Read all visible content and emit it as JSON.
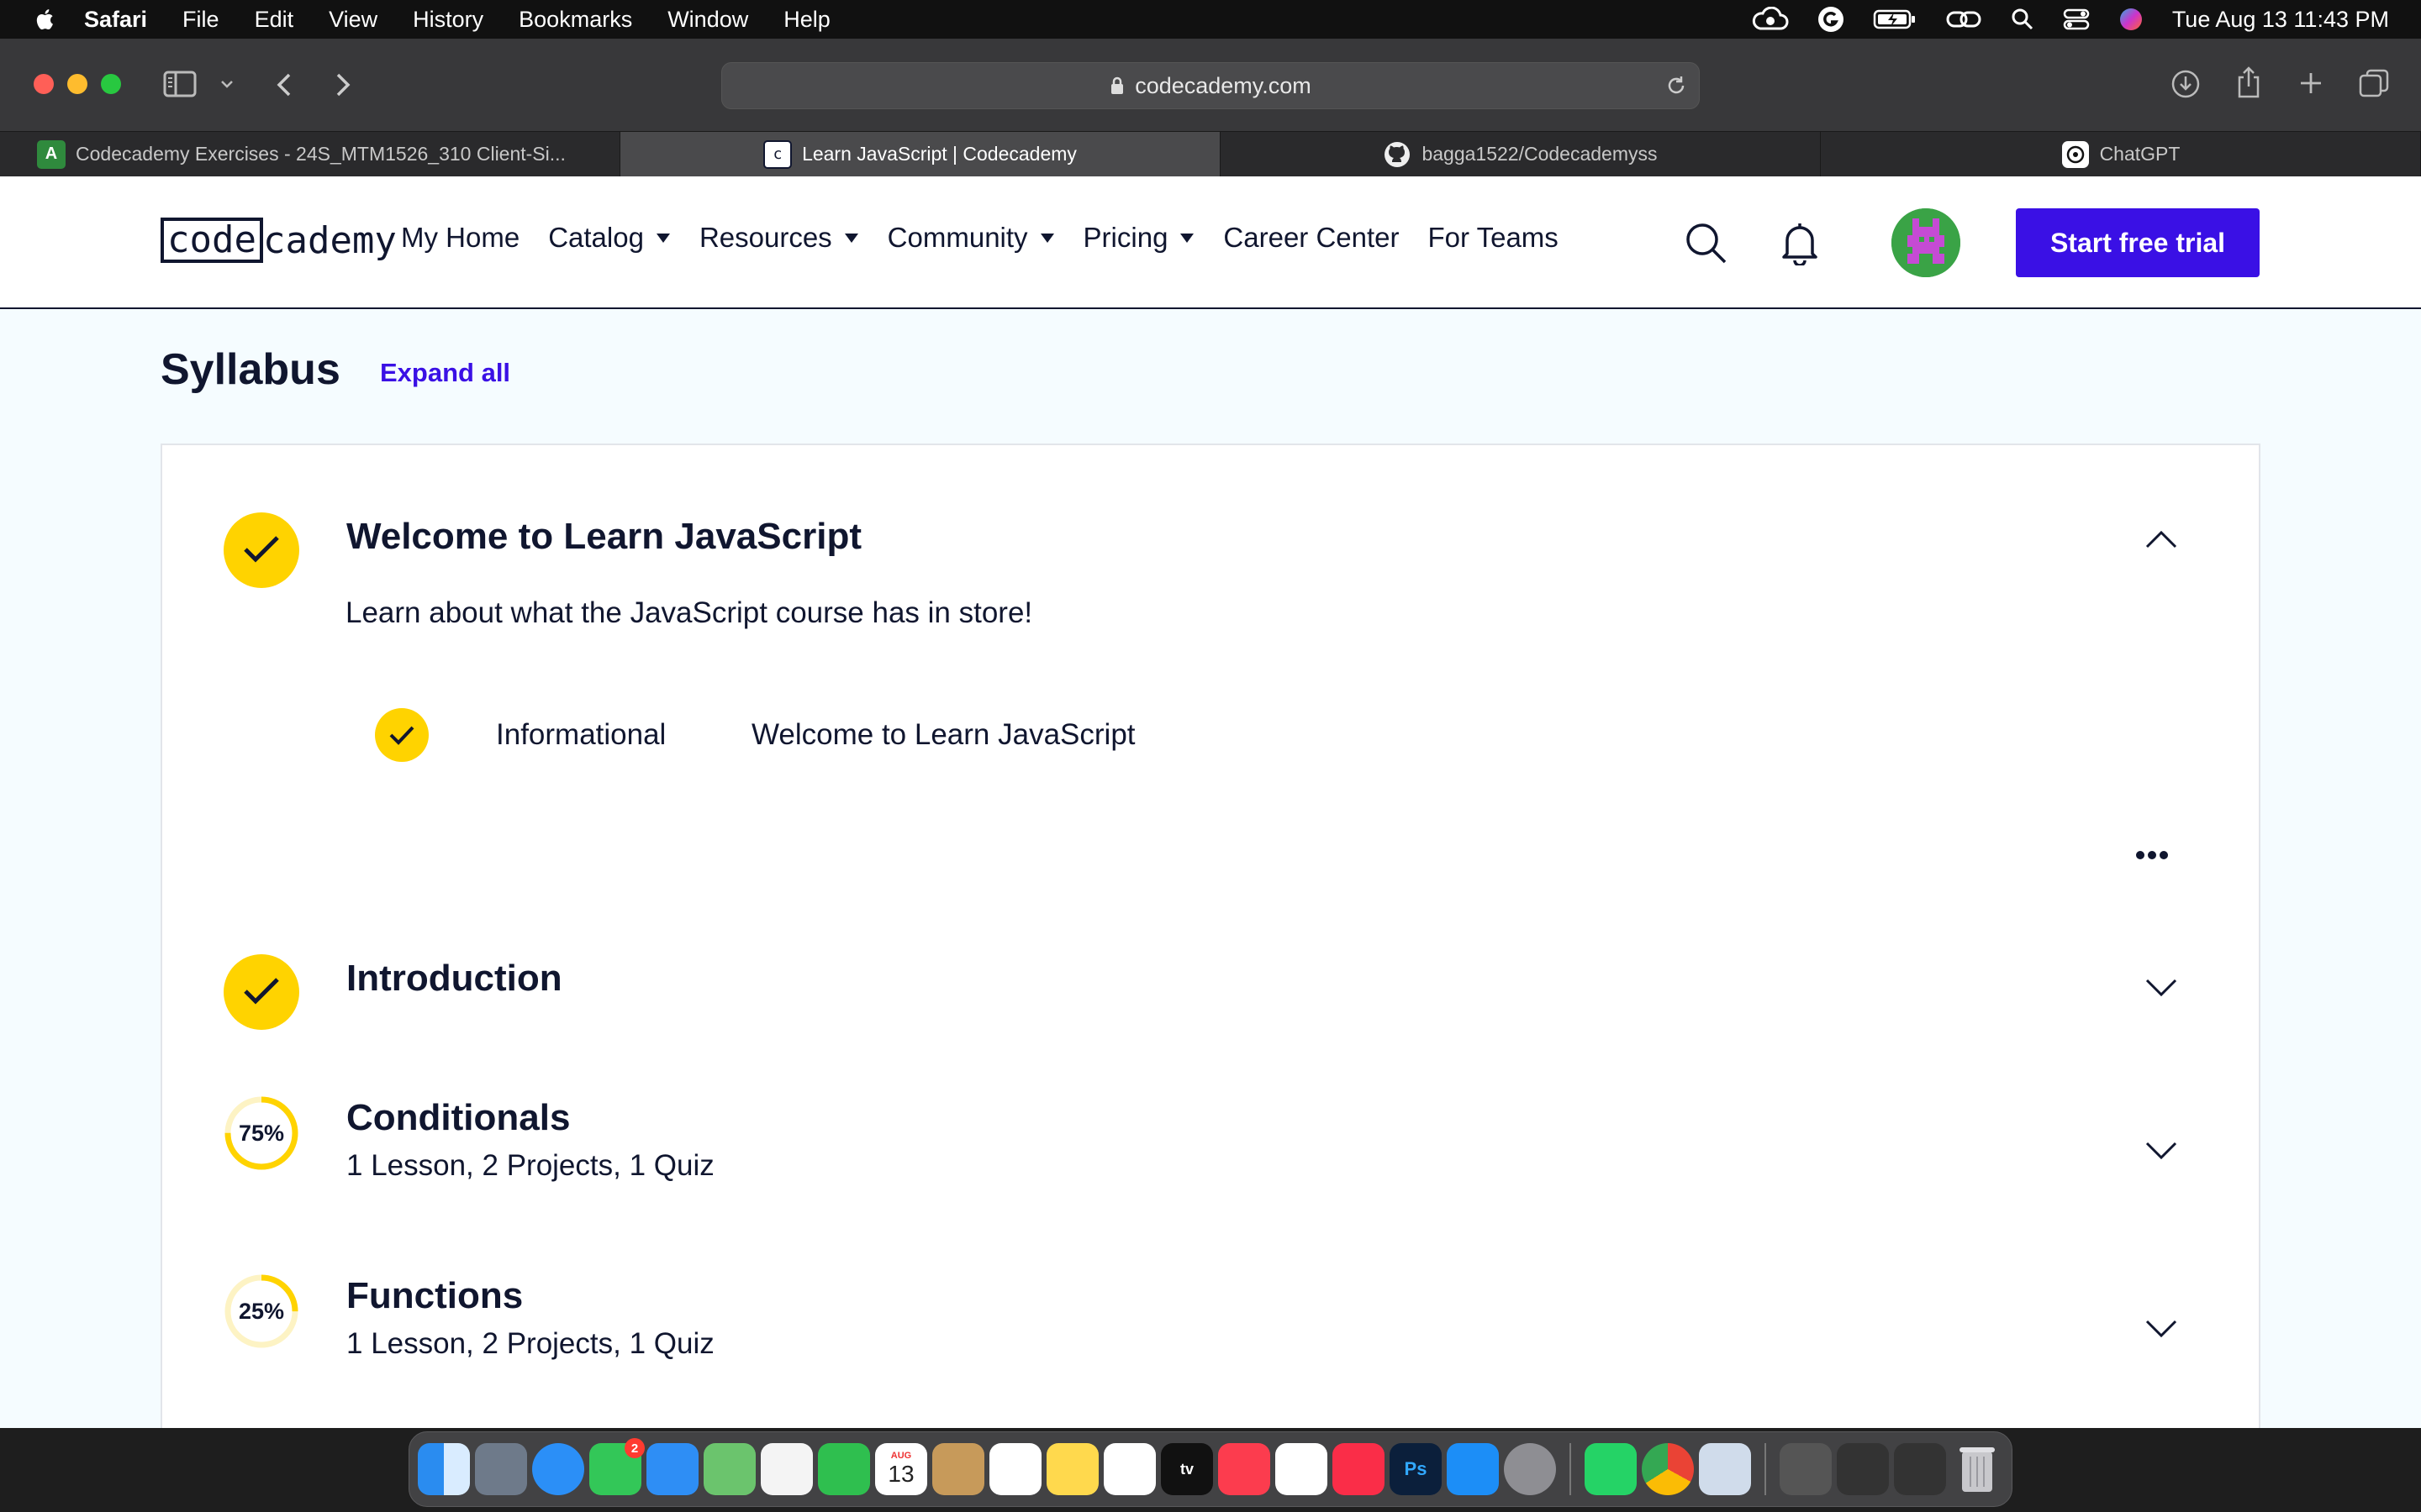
{
  "menubar": {
    "app": "Safari",
    "items": [
      "File",
      "Edit",
      "View",
      "History",
      "Bookmarks",
      "Window",
      "Help"
    ],
    "clock": "Tue Aug 13  11:43 PM"
  },
  "browser": {
    "url": "codecademy.com",
    "tabs": [
      {
        "title": "Codecademy Exercises - 24S_MTM1526_310 Client-Si...",
        "icon": "codecademy-exercises-icon",
        "active": false
      },
      {
        "title": "Learn JavaScript | Codecademy",
        "icon": "codecademy-icon",
        "active": true
      },
      {
        "title": "bagga1522/Codecademyss",
        "icon": "github-icon",
        "active": false
      },
      {
        "title": "ChatGPT",
        "icon": "chatgpt-icon",
        "active": false
      }
    ]
  },
  "site": {
    "logo_left": "code",
    "logo_right": "cademy",
    "nav": [
      {
        "label": "My Home",
        "dropdown": false
      },
      {
        "label": "Catalog",
        "dropdown": true
      },
      {
        "label": "Resources",
        "dropdown": true
      },
      {
        "label": "Community",
        "dropdown": true
      },
      {
        "label": "Pricing",
        "dropdown": true
      },
      {
        "label": "Career Center",
        "dropdown": false
      },
      {
        "label": "For Teams",
        "dropdown": false
      }
    ],
    "cta": "Start free trial"
  },
  "syllabus": {
    "title": "Syllabus",
    "expand_all": "Expand all",
    "modules": [
      {
        "title": "Welcome to Learn JavaScript",
        "description": "Learn about what the JavaScript course has in store!",
        "status": "complete",
        "expanded": true,
        "lessons": [
          {
            "type": "Informational",
            "name": "Welcome to Learn JavaScript",
            "status": "complete"
          }
        ]
      },
      {
        "title": "Introduction",
        "status": "complete",
        "expanded": false
      },
      {
        "title": "Conditionals",
        "summary": "1 Lesson, 2 Projects, 1 Quiz",
        "progress": 75,
        "progress_label": "75%",
        "expanded": false
      },
      {
        "title": "Functions",
        "summary": "1 Lesson, 2 Projects, 1 Quiz",
        "progress": 25,
        "progress_label": "25%",
        "expanded": false
      }
    ]
  },
  "dock": {
    "calendar_day": "13",
    "calendar_month": "AUG",
    "messages_badge": "2"
  },
  "colors": {
    "brand_blue": "#3a10e5",
    "check_yellow": "#ffd300",
    "navy": "#10162f"
  }
}
